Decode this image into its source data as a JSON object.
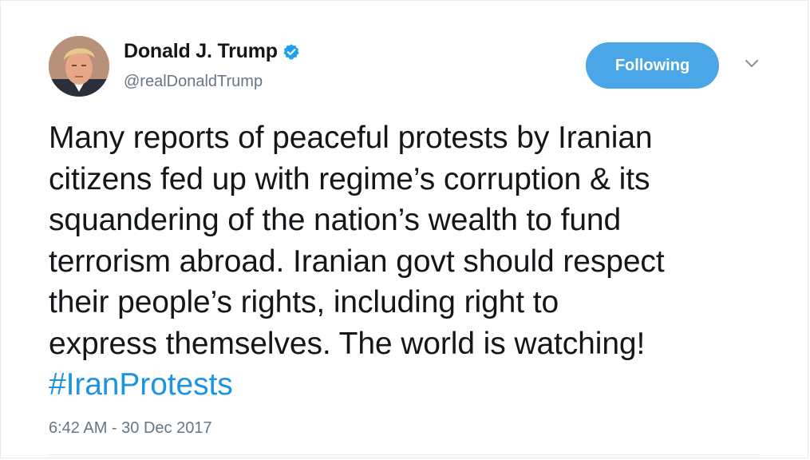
{
  "author": {
    "display_name": "Donald J. Trump",
    "handle": "@realDonaldTrump",
    "verified": true
  },
  "follow_button": {
    "label": "Following"
  },
  "menu": {
    "icon": "chevron-down-icon"
  },
  "tweet": {
    "lines": [
      "Many reports of peaceful protests by Iranian",
      "citizens fed up with regime’s corruption & its",
      "squandering of the nation’s wealth to fund",
      "terrorism abroad. Iranian govt should respect",
      "their people’s rights, including right to",
      "express themselves. The world is watching!"
    ],
    "hashtag": "#IranProtests",
    "timestamp": "6:42 AM - 30 Dec 2017"
  },
  "colors": {
    "accent": "#1b95e0",
    "button_bg": "#4aa6e6",
    "muted": "#657786"
  }
}
